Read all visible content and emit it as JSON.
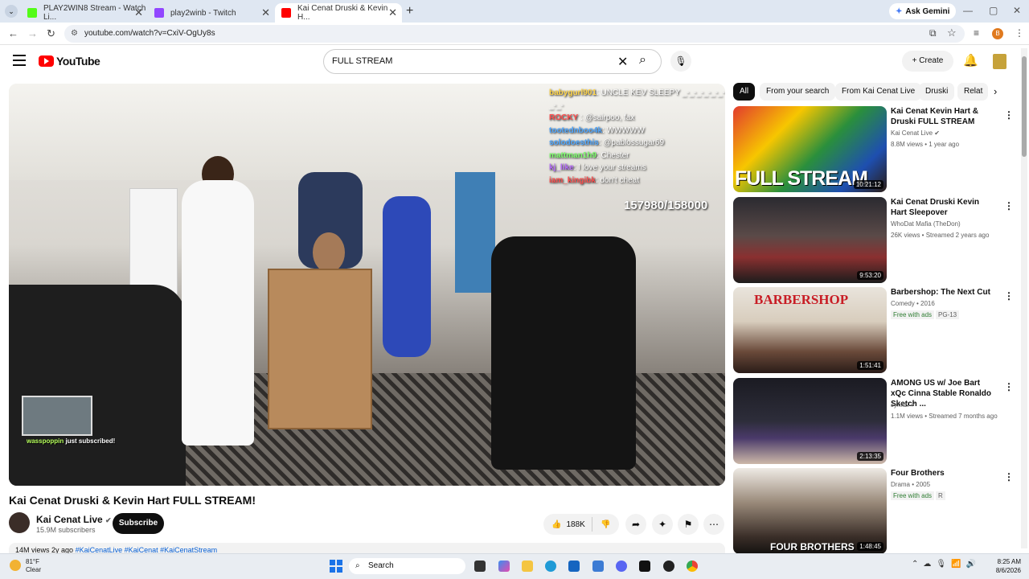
{
  "browser": {
    "tabs": [
      {
        "title": "PLAY2WIN8 Stream - Watch Li...",
        "favicon_color": "#53fc18",
        "active": false
      },
      {
        "title": "play2winb - Twitch",
        "favicon_color": "#9146ff",
        "active": false
      },
      {
        "title": "Kai Cenat Druski & Kevin H...",
        "favicon_color": "#ff0000",
        "active": true
      }
    ],
    "ask_gemini": "Ask Gemini",
    "url": "youtube.com/watch?v=CxiV-OgUy8s",
    "profile_initial": "B"
  },
  "youtube": {
    "logo_text": "YouTube",
    "search_value": "FULL STREAM",
    "create_label": "Create"
  },
  "video": {
    "chat": [
      {
        "user": "babygurl901",
        "text": "UNCLE KEV SLEEPY _-_-_-_-_-_-_-_-"
      },
      {
        "user": "ROCKY",
        "text": ": @sairpoo, fax"
      },
      {
        "user": "tootednboo4k",
        "text": "WWWWW"
      },
      {
        "user": "solodoesthis",
        "text": "@pablossugar69"
      },
      {
        "user": "mattman1h9",
        "text": "Chester"
      },
      {
        "user": "kj_like",
        "text": "I love your streams"
      },
      {
        "user": "iam_kingibk",
        "text": "don't cheat"
      }
    ],
    "counter": "157980/158000",
    "sub_alert_user": "wasspoppin",
    "sub_alert_text": "just subscribed!",
    "title": "Kai Cenat Druski & Kevin Hart FULL STREAM!",
    "channel": "Kai Cenat Live",
    "subscribers": "15.9M subscribers",
    "subscribe_label": "Subscribe",
    "likes": "188K",
    "description_meta": "14M views  2y ago",
    "description_tags": "#KaiCenatLive #KaiCenat #KaiCenatStream"
  },
  "chips": [
    "All",
    "From your search",
    "From Kai Cenat Live",
    "Druski",
    "Relat"
  ],
  "recommendations": [
    {
      "title": "Kai Cenat Kevin Hart & Druski FULL STREAM",
      "channel": "Kai Cenat Live",
      "verified": true,
      "meta": "8.8M views • 1 year ago",
      "duration": "10:21:12",
      "thumb_text": "FULL STREAM"
    },
    {
      "title": "Kai Cenat Druski Kevin Hart Sleepover",
      "channel": "WhoDat Mafia (TheDon)",
      "verified": false,
      "meta": "26K views • Streamed 2 years ago",
      "duration": "9:53:20",
      "thumb_text": ""
    },
    {
      "title": "Barbershop: The Next Cut",
      "channel": "Comedy • 2016",
      "verified": false,
      "meta": "",
      "free_label": "Free with ads",
      "rating": "PG-13",
      "duration": "1:51:41",
      "thumb_text": "BARBERSHOP"
    },
    {
      "title": "AMONG US w/ Joe Bart xQc Cinna Stable Ronaldo Sketch ...",
      "channel": "Jynxzi",
      "verified": true,
      "meta": "1.1M views • Streamed 7 months ago",
      "duration": "2:13:35",
      "thumb_text": ""
    },
    {
      "title": "Four Brothers",
      "channel": "Drama • 2005",
      "verified": false,
      "meta": "",
      "free_label": "Free with ads",
      "rating": "R",
      "duration": "1:48:45",
      "thumb_text": "FOUR BROTHERS"
    }
  ],
  "taskbar": {
    "temp": "81°F",
    "condition": "Clear",
    "search_placeholder": "Search",
    "time": "8:25 AM",
    "date": "8/6/2026"
  }
}
